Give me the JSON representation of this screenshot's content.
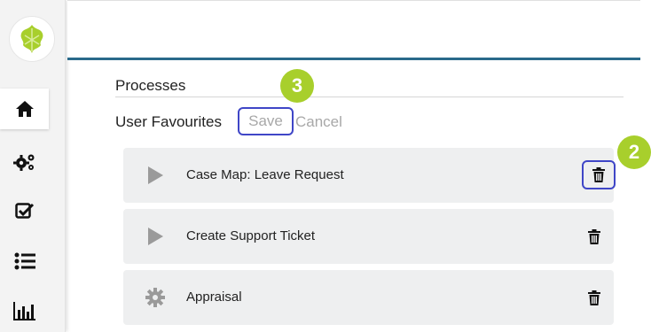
{
  "sidebar": {
    "items": [
      {
        "icon": "home-icon",
        "active": true
      },
      {
        "icon": "cogs-icon",
        "active": false
      },
      {
        "icon": "checkbox-icon",
        "active": false
      },
      {
        "icon": "list-icon",
        "active": false
      },
      {
        "icon": "chart-icon",
        "active": false
      }
    ],
    "logo_icon": "leaf-logo"
  },
  "header": {
    "accent_color": "#2a6a8a"
  },
  "main": {
    "section_title": "Processes",
    "favourites_label": "User Favourites",
    "save_label": "Save",
    "cancel_label": "Cancel",
    "favourites": [
      {
        "label": "Case Map: Leave Request",
        "icon": "play-icon"
      },
      {
        "label": "Create Support Ticket",
        "icon": "play-icon"
      },
      {
        "label": "Appraisal",
        "icon": "gear-icon"
      }
    ]
  },
  "annotations": {
    "save_step": "3",
    "delete_step": "2",
    "badge_color": "#a8cf2c",
    "highlight_color": "#3f46c7"
  }
}
